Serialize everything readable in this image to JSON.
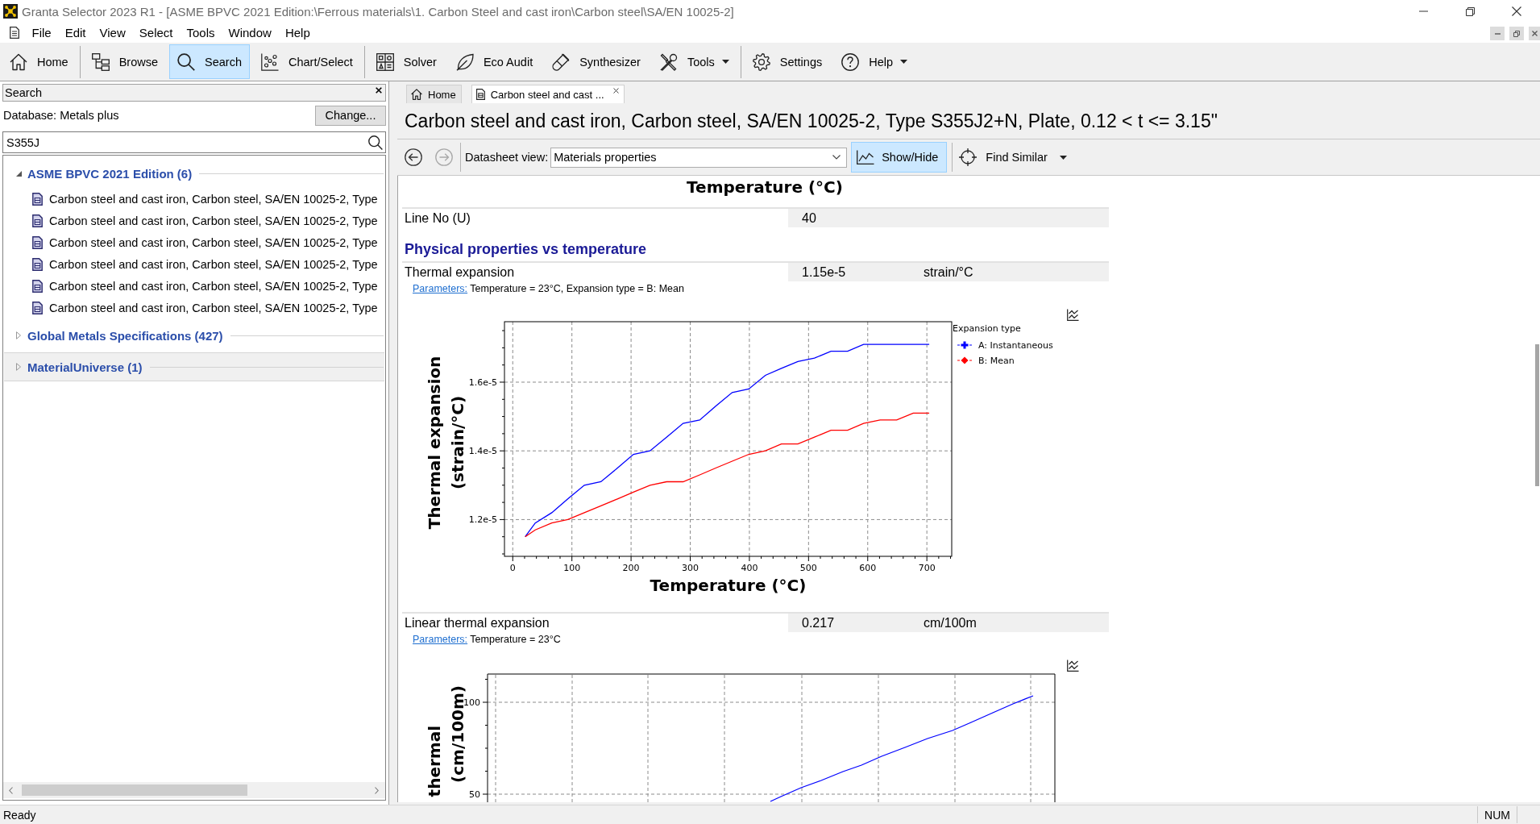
{
  "window": {
    "title": "Granta Selector 2023 R1 - [ASME BPVC 2021 Edition:\\Ferrous materials\\1. Carbon Steel and cast iron\\Carbon steel\\SA/EN 10025-2]"
  },
  "menu": [
    "File",
    "Edit",
    "View",
    "Select",
    "Tools",
    "Window",
    "Help"
  ],
  "toolbar": [
    {
      "items": [
        {
          "label": "Home",
          "selected": false,
          "dropdown": false
        }
      ]
    },
    {
      "items": [
        {
          "label": "Browse",
          "selected": false,
          "dropdown": false
        },
        {
          "label": "Search",
          "selected": true,
          "dropdown": false
        },
        {
          "label": "Chart/Select",
          "selected": false,
          "dropdown": false
        }
      ]
    },
    {
      "items": [
        {
          "label": "Solver",
          "selected": false,
          "dropdown": false
        },
        {
          "label": "Eco Audit",
          "selected": false,
          "dropdown": false
        },
        {
          "label": "Synthesizer",
          "selected": false,
          "dropdown": false
        },
        {
          "label": "Tools",
          "selected": false,
          "dropdown": true
        }
      ]
    },
    {
      "items": [
        {
          "label": "Settings",
          "selected": false,
          "dropdown": false
        },
        {
          "label": "Help",
          "selected": false,
          "dropdown": true
        }
      ]
    }
  ],
  "search_panel": {
    "title": "Search",
    "database": "Database: Metals plus",
    "change_button": "Change...",
    "query": "S355J",
    "groups": [
      {
        "label": "ASME BPVC 2021 Edition (6)",
        "expanded": true,
        "selected": false,
        "children": [
          {
            "label": "Carbon steel and cast iron, Carbon steel, SA/EN 10025-2, Type"
          },
          {
            "label": "Carbon steel and cast iron, Carbon steel, SA/EN 10025-2, Type"
          },
          {
            "label": "Carbon steel and cast iron, Carbon steel, SA/EN 10025-2, Type"
          },
          {
            "label": "Carbon steel and cast iron, Carbon steel, SA/EN 10025-2, Type"
          },
          {
            "label": "Carbon steel and cast iron, Carbon steel, SA/EN 10025-2, Type"
          },
          {
            "label": "Carbon steel and cast iron, Carbon steel, SA/EN 10025-2, Type"
          }
        ]
      },
      {
        "label": "Global Metals Specifications (427)",
        "expanded": false,
        "selected": false
      },
      {
        "label": "MaterialUniverse (1)",
        "expanded": false,
        "selected": true
      }
    ]
  },
  "document_tabs": [
    {
      "label": "Home",
      "selected": false,
      "closable": false
    },
    {
      "label": "Carbon steel and cast ...",
      "selected": true,
      "closable": true
    }
  ],
  "datasheet": {
    "title": "Carbon steel and cast iron, Carbon steel, SA/EN 10025-2, Type S355J2+N, Plate, 0.12 < t <= 3.15\"",
    "back": {
      "disabled": false
    },
    "forward": {
      "disabled": true
    },
    "view_label": "Datasheet view:",
    "view_value": "Materials properties",
    "show_hide": {
      "label": "Show/Hide",
      "selected": true
    },
    "find_similar": "Find Similar",
    "sections": [
      {
        "kind": "caption",
        "text": "Temperature (°C)"
      },
      {
        "kind": "row",
        "label": "Line No (U)",
        "value": "40"
      },
      {
        "kind": "heading",
        "text": "Physical properties vs temperature"
      },
      {
        "kind": "row",
        "label": "Thermal expansion",
        "value": "1.15e-5",
        "unit": "strain/°C"
      },
      {
        "kind": "parameters",
        "link": "Parameters:",
        "text": "Temperature = 23°C, Expansion type = B: Mean"
      },
      {
        "kind": "chart",
        "chart_data": {
          "type": "line",
          "xlabel": "Temperature (°C)",
          "ylabel": "Thermal expansion (strain/°C)",
          "grid": true,
          "legend": {
            "title": "Expansion type"
          },
          "x": [
            21,
            38,
            66,
            93,
            121,
            149,
            177,
            204,
            232,
            260,
            288,
            316,
            343,
            371,
            399,
            427,
            454,
            482,
            510,
            538,
            566,
            593,
            621,
            649,
            677,
            704
          ],
          "series": [
            {
              "name": "A: Instantaneous",
              "color": "#0000ff",
              "values": [
                1.15e-05,
                1.19e-05,
                1.22e-05,
                1.26e-05,
                1.3e-05,
                1.31e-05,
                1.35e-05,
                1.39e-05,
                1.4e-05,
                1.44e-05,
                1.48e-05,
                1.49e-05,
                1.53e-05,
                1.57e-05,
                1.58e-05,
                1.62e-05,
                1.64e-05,
                1.66e-05,
                1.67e-05,
                1.69e-05,
                1.69e-05,
                1.71e-05,
                1.71e-05,
                1.71e-05,
                1.71e-05,
                1.71e-05
              ]
            },
            {
              "name": "B: Mean",
              "color": "#ff0000",
              "values": [
                1.15e-05,
                1.17e-05,
                1.19e-05,
                1.2e-05,
                1.22e-05,
                1.24e-05,
                1.26e-05,
                1.28e-05,
                1.3e-05,
                1.31e-05,
                1.31e-05,
                1.33e-05,
                1.35e-05,
                1.37e-05,
                1.39e-05,
                1.4e-05,
                1.42e-05,
                1.42e-05,
                1.44e-05,
                1.46e-05,
                1.46e-05,
                1.48e-05,
                1.49e-05,
                1.49e-05,
                1.51e-05,
                1.51e-05
              ]
            }
          ],
          "xlim": [
            -14,
            742
          ],
          "ylim": [
            1.093e-05,
            1.776e-05
          ],
          "xticks": [
            {
              "value": 0,
              "label": "0"
            },
            {
              "value": 100,
              "label": "100"
            },
            {
              "value": 200,
              "label": "200"
            },
            {
              "value": 300,
              "label": "300"
            },
            {
              "value": 400,
              "label": "400"
            },
            {
              "value": 500,
              "label": "500"
            },
            {
              "value": 600,
              "label": "600"
            },
            {
              "value": 700,
              "label": "700"
            }
          ],
          "yticks": [
            {
              "value": 1.2e-05,
              "label": "1.2e-5"
            },
            {
              "value": 1.4e-05,
              "label": "1.4e-5"
            },
            {
              "value": 1.6e-05,
              "label": "1.6e-5"
            }
          ]
        }
      },
      {
        "kind": "row",
        "label": "Linear thermal expansion",
        "value": "0.217",
        "unit": "cm/100m"
      },
      {
        "kind": "parameters",
        "link": "Parameters:",
        "text": "Temperature = 23°C"
      },
      {
        "kind": "chart_picture",
        "y_tick_labels": [
          "100",
          "50"
        ],
        "y_title_lines": [
          "thermal",
          "(cm/100m)"
        ]
      }
    ]
  },
  "status_bar": {
    "text": "Ready",
    "indicators": [
      "NUM"
    ]
  }
}
